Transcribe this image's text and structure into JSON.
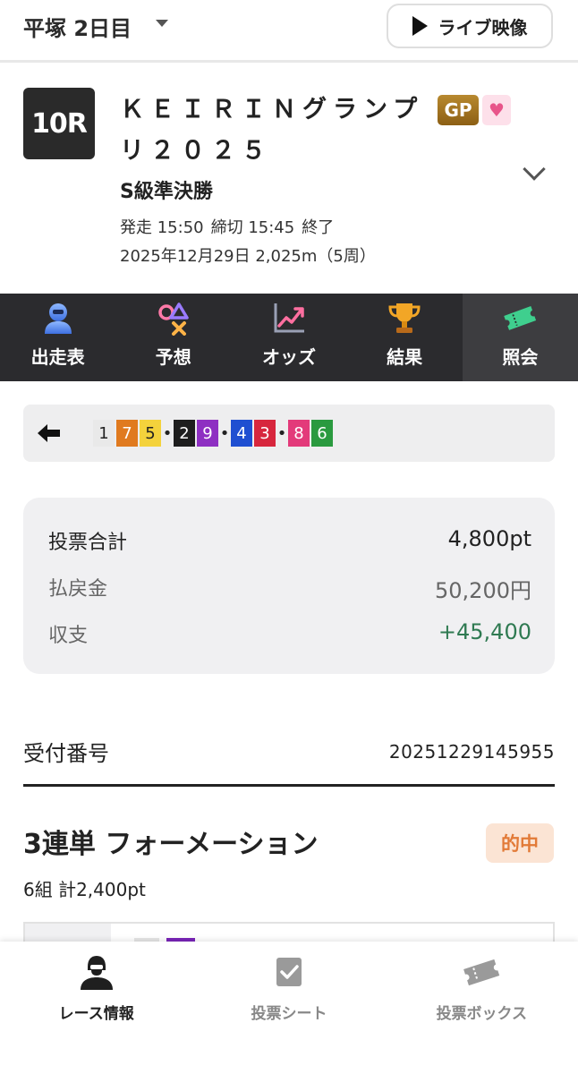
{
  "header": {
    "venue": "平塚 2日目",
    "live_label": "ライブ映像"
  },
  "race": {
    "number": "10R",
    "title": "ＫＥＩＲＩＮグランプリ２０２５",
    "gp_badge": "GP",
    "class": "S級準決勝",
    "start": "発走 15:50",
    "deadline": "締切 15:45",
    "status": "終了",
    "date_distance": "2025年12月29日 2,025m（5周）"
  },
  "tabs": [
    {
      "label": "出走表",
      "icon": "racer-icon"
    },
    {
      "label": "予想",
      "icon": "prediction-icon"
    },
    {
      "label": "オッズ",
      "icon": "odds-chart-icon"
    },
    {
      "label": "結果",
      "icon": "trophy-icon"
    },
    {
      "label": "照会",
      "icon": "ticket-icon",
      "active": true
    }
  ],
  "combination": {
    "groups": [
      [
        "1",
        "7",
        "5"
      ],
      [
        "2",
        "9"
      ],
      [
        "4",
        "3"
      ],
      [
        "8",
        "6"
      ]
    ],
    "colors": {
      "1": {
        "bg": "#e9e9e9",
        "fg": "#222222"
      },
      "2": {
        "bg": "#1e1e1e",
        "fg": "#ffffff"
      },
      "3": {
        "bg": "#d7263d",
        "fg": "#ffffff"
      },
      "4": {
        "bg": "#1f4fd1",
        "fg": "#ffffff"
      },
      "5": {
        "bg": "#f4d23c",
        "fg": "#222222"
      },
      "6": {
        "bg": "#2a9a3f",
        "fg": "#ffffff"
      },
      "7": {
        "bg": "#e07a1f",
        "fg": "#ffffff"
      },
      "8": {
        "bg": "#e33a7a",
        "fg": "#ffffff"
      },
      "9": {
        "bg": "#8e2fc2",
        "fg": "#ffffff"
      }
    }
  },
  "summary": {
    "total_label": "投票合計",
    "total_value": "4,800pt",
    "payout_label": "払戻金",
    "payout_value": "50,200円",
    "balance_label": "収支",
    "balance_value": "+45,400",
    "balance_color": "#2f7a52"
  },
  "receipt": {
    "label": "受付番号",
    "number": "20251229145955"
  },
  "bet": {
    "type": "3連単 フォーメーション",
    "result_badge": "的中",
    "count": "6組 計2,400pt"
  },
  "bottom_nav": [
    {
      "label": "レース情報",
      "icon": "race-info-icon",
      "active": true
    },
    {
      "label": "投票シート",
      "icon": "vote-sheet-icon"
    },
    {
      "label": "投票ボックス",
      "icon": "vote-box-icon"
    }
  ]
}
